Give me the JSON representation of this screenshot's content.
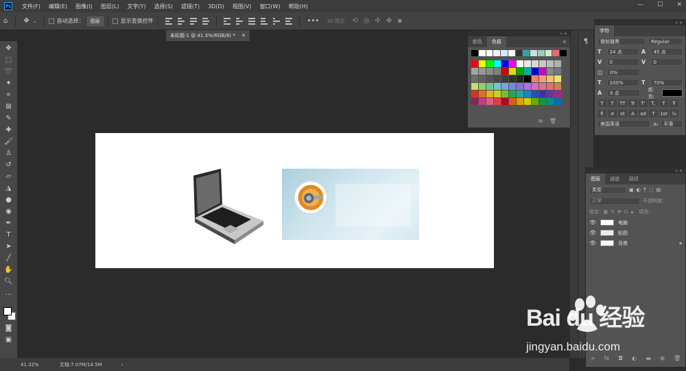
{
  "app": {
    "logo": "Ps"
  },
  "menu": [
    "文件(F)",
    "编辑(E)",
    "图像(I)",
    "图层(L)",
    "文字(Y)",
    "选择(S)",
    "滤镜(T)",
    "3D(D)",
    "视图(V)",
    "窗口(W)",
    "帮助(H)"
  ],
  "window_controls": [
    "—",
    "☐",
    "✕"
  ],
  "options": {
    "auto_select_label": "自动选择：",
    "auto_select_value": "图层",
    "show_transform_label": "显示变换控件",
    "more": "•••",
    "mode_3d_label": "3D 模式："
  },
  "document_tab": {
    "title": "未标题-1 @ 41.3%(RGB/8) *",
    "close": "✕"
  },
  "status": {
    "zoom": "41.32%",
    "doc_info": "文档:7.07M/14.5M",
    "arrow": "›"
  },
  "swatches_panel": {
    "tabs": [
      "颜色",
      "色板"
    ],
    "active_tab": "色板",
    "recent": [
      "#000000",
      "#ffffff",
      "#ffffff",
      "#f0f0f0",
      "#cceeff",
      "#ffffff",
      "#333333",
      "#22aaaa",
      "#ccdddd",
      "#99ccbb",
      "#cceecc",
      "#ee6677",
      "#000000"
    ],
    "grid": [
      "#ff0000",
      "#ffff00",
      "#00ff00",
      "#00ffff",
      "#0000ff",
      "#ff00ff",
      "#ffffff",
      "#e8e8e8",
      "#d8d8d8",
      "#c8c8c8",
      "#bcbcbc",
      "#b0b0b0",
      "#a4a4a4",
      "#989898",
      "#8c8c8c",
      "#808080",
      "#cc0000",
      "#dddd00",
      "#00aa00",
      "#00aaaa",
      "#0000cc",
      "#cc00cc",
      "#888888",
      "#777777",
      "#6c6c6c",
      "#606060",
      "#545454",
      "#484848",
      "#3c3c3c",
      "#303030",
      "#242424",
      "#000000",
      "#f08070",
      "#f0a080",
      "#f0c070",
      "#f0e070",
      "#c0e070",
      "#90d070",
      "#70c890",
      "#70c8c8",
      "#70a8e0",
      "#7088e0",
      "#8870e0",
      "#b070e0",
      "#d070c0",
      "#e07090",
      "#e07070",
      "#d08050",
      "#e03020",
      "#e07020",
      "#e0b020",
      "#c8d020",
      "#70c030",
      "#20a850",
      "#20a8a0",
      "#2080c8",
      "#2050c0",
      "#4030b0",
      "#7030a8",
      "#a02890",
      "#902060",
      "#c04080",
      "#e06080",
      "#e04040",
      "#c00020",
      "#e06000",
      "#e0a000",
      "#d0d000",
      "#60b000",
      "#00a040",
      "#009090",
      "#0070b0"
    ]
  },
  "character_panel": {
    "title": "字符",
    "font_family": "微软雅黑",
    "font_style": "Regular",
    "font_size": "24 点",
    "leading": "45 点",
    "kerning": "0",
    "tracking": "0",
    "tsume": "0%",
    "vscale": "100%",
    "hscale": "70%",
    "baseline": "0 点",
    "color_label": "颜色:",
    "format_buttons": [
      "T",
      "T",
      "TT",
      "Tr",
      "T'",
      "T,",
      "T",
      "Ŧ"
    ],
    "extra_buttons": [
      "fi",
      "ơ",
      "st",
      "A",
      "ad",
      "T",
      "1st",
      "½"
    ],
    "language": "美国英语",
    "aa_label": "aₐ",
    "aa_value": "平滑"
  },
  "layers_panel": {
    "tabs": [
      "图层",
      "通道",
      "路径"
    ],
    "active_tab": "图层",
    "filter_label": "类型",
    "blend_mode": "正常",
    "opacity_label": "不透明度:",
    "lock_label": "锁定:",
    "fill_label": "填充:",
    "layers": [
      {
        "name": "电脑",
        "visible": true
      },
      {
        "name": "贴图",
        "visible": true
      },
      {
        "name": "背景",
        "visible": true,
        "locked": true
      }
    ],
    "footer_icons": [
      "∞",
      "fx",
      "◘",
      "◐",
      "▬",
      "⊞",
      "🗑"
    ]
  },
  "watermark": {
    "brand": "Bai du 经验",
    "url": "jingyan.baidu.com"
  },
  "colors": {
    "canvas_bg": "#2b2b2b",
    "panel_bg": "#535353",
    "accent": "#31a8ff"
  }
}
